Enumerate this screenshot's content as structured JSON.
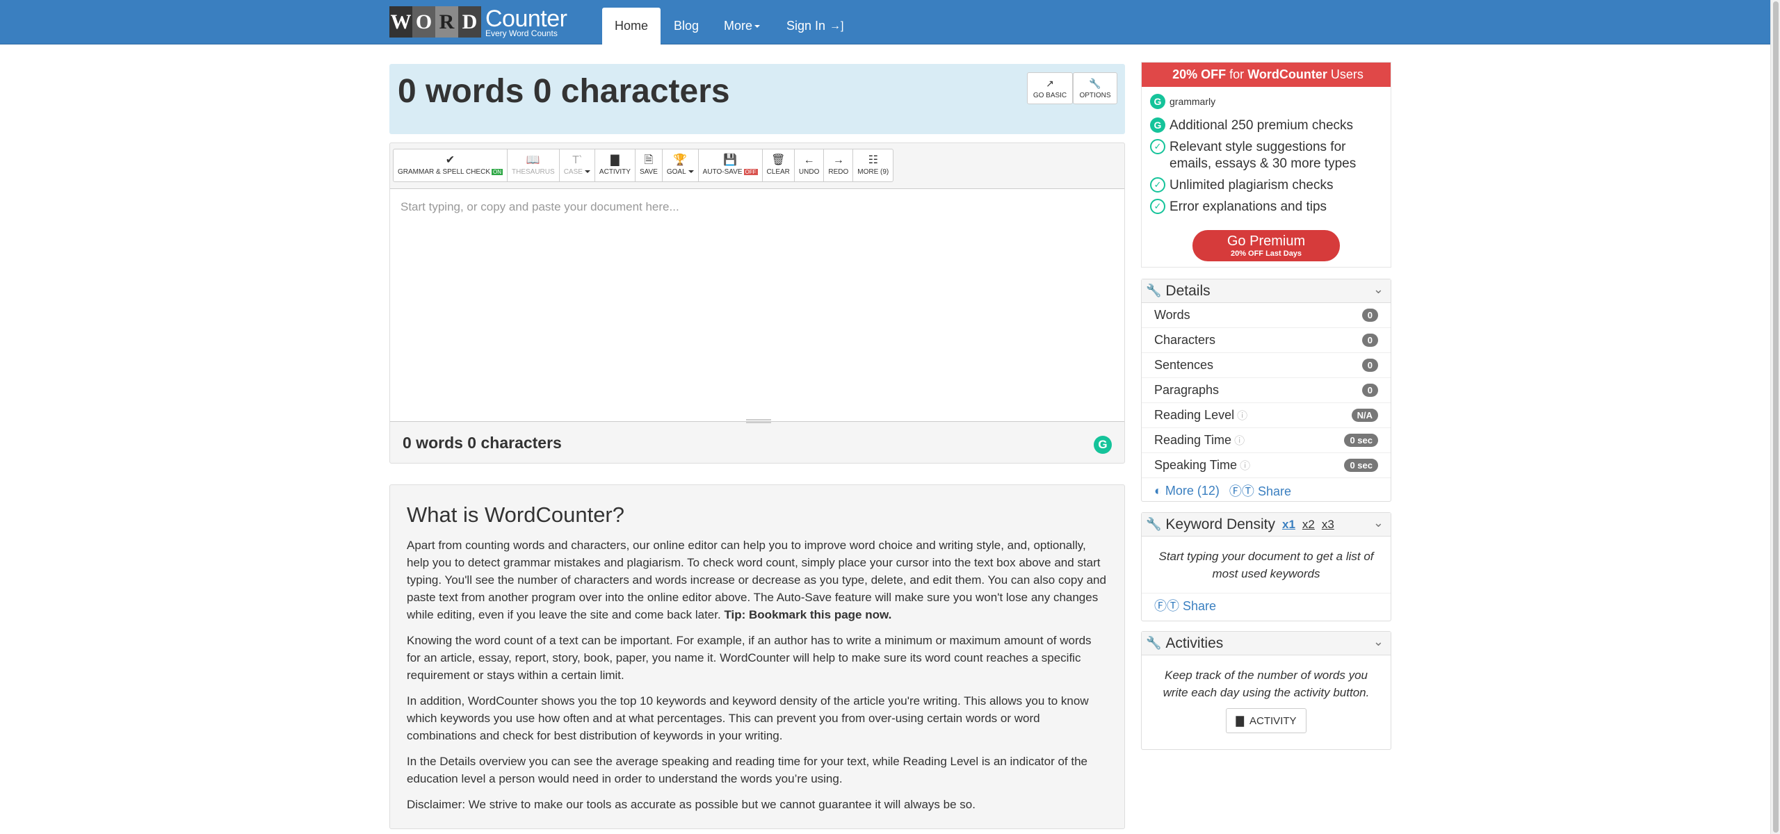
{
  "nav": {
    "logo_letters": [
      "W",
      "O",
      "R",
      "D"
    ],
    "logo_name": "Counter",
    "logo_tagline": "Every Word Counts",
    "home": "Home",
    "blog": "Blog",
    "more": "More",
    "signin": "Sign In"
  },
  "header": {
    "count": "0 words 0 characters",
    "go_basic": "GO BASIC",
    "options": "OPTIONS"
  },
  "toolbar": {
    "grammar": "GRAMMAR & SPELL CHECK",
    "grammar_state": "ON",
    "thesaurus": "THESAURUS",
    "case": "CASE",
    "activity": "ACTIVITY",
    "save": "SAVE",
    "goal": "GOAL",
    "autosave": "AUTO-SAVE",
    "autosave_state": "OFF",
    "clear": "CLEAR",
    "undo": "UNDO",
    "redo": "REDO",
    "more": "MORE (9)"
  },
  "editor": {
    "placeholder": "Start typing, or copy and paste your document here...",
    "bottom_count": "0 words 0 characters"
  },
  "info": {
    "title": "What is WordCounter?",
    "p1": "Apart from counting words and characters, our online editor can help you to improve word choice and writing style, and, optionally, help you to detect grammar mistakes and plagiarism. To check word count, simply place your cursor into the text box above and start typing. You'll see the number of characters and words increase or decrease as you type, delete, and edit them. You can also copy and paste text from another program over into the online editor above. The Auto-Save feature will make sure you won't lose any changes while editing, even if you leave the site and come back later.",
    "p1_tip": "Tip: Bookmark this page now.",
    "p2": "Knowing the word count of a text can be important. For example, if an author has to write a minimum or maximum amount of words for an article, essay, report, story, book, paper, you name it. WordCounter will help to make sure its word count reaches a specific requirement or stays within a certain limit.",
    "p3": "In addition, WordCounter shows you the top 10 keywords and keyword density of the article you're writing. This allows you to know which keywords you use how often and at what percentages. This can prevent you from over-using certain words or word combinations and check for best distribution of keywords in your writing.",
    "p4": "In the Details overview you can see the average speaking and reading time for your text, while Reading Level is an indicator of the education level a person would need in order to understand the words you’re using.",
    "p5": "Disclaimer: We strive to make our tools as accurate as possible but we cannot guarantee it will always be so."
  },
  "promo": {
    "head_pre": "20% OFF",
    "head_mid": "for",
    "head_brand": "WordCounter",
    "head_post": "Users",
    "brand": "grammarly",
    "items": [
      "Additional 250 premium checks",
      "Relevant style suggestions for emails, essays & 30 more types",
      "Unlimited plagiarism checks",
      "Error explanations and tips"
    ],
    "btn_main": "Go Premium",
    "btn_sub": "20% OFF Last Days"
  },
  "details": {
    "title": "Details",
    "rows": [
      {
        "label": "Words",
        "value": "0"
      },
      {
        "label": "Characters",
        "value": "0"
      },
      {
        "label": "Sentences",
        "value": "0"
      },
      {
        "label": "Paragraphs",
        "value": "0"
      },
      {
        "label": "Reading Level",
        "value": "N/A"
      },
      {
        "label": "Reading Time",
        "value": "0 sec"
      },
      {
        "label": "Speaking Time",
        "value": "0 sec"
      }
    ],
    "more": "More (12)",
    "share": "Share"
  },
  "keyword": {
    "title": "Keyword Density",
    "x1": "x1",
    "x2": "x2",
    "x3": "x3",
    "body": "Start typing your document to get a list of most used keywords",
    "share": "Share"
  },
  "activities": {
    "title": "Activities",
    "body": "Keep track of the number of words you write each day using the activity button.",
    "button": "ACTIVITY"
  },
  "colors": {
    "navbar": "#3a7fc0",
    "header_bg": "#d9ecf5",
    "promo_red": "#e04848",
    "grammarly_green": "#15c39a"
  }
}
